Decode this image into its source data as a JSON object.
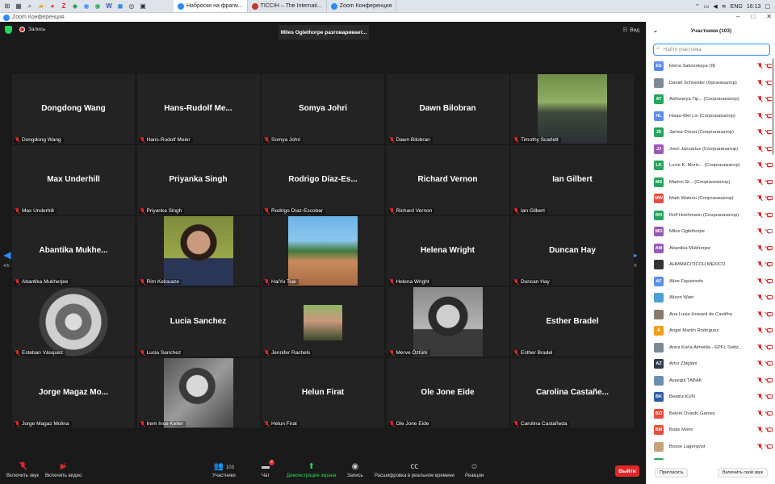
{
  "taskbar": {
    "tabs": [
      {
        "label": "Наброски на фрагм...",
        "color": "#2d8cff",
        "active": true
      },
      {
        "label": "TICCIH – The Internati...",
        "color": "#c0392b",
        "active": false
      },
      {
        "label": "Zoom Конференция",
        "color": "#2d8cff",
        "active": false
      }
    ],
    "lang": "ENG",
    "time": "16:13"
  },
  "window": {
    "title": "Zoom Конференция"
  },
  "topbar": {
    "record_label": "Запись",
    "speaker": "Miles Oglethorpe разговаривает...",
    "view_label": "Вид"
  },
  "grid": {
    "page_left": "4/5",
    "page_right": "4/5",
    "tiles": [
      {
        "big": "Dongdong Wang",
        "label": "Dongdong Wang",
        "photo": ""
      },
      {
        "big": "Hans-Rudolf  Me...",
        "label": "Hans-Rudolf Meier",
        "photo": ""
      },
      {
        "big": "Somya Johri",
        "label": "Somya Johri",
        "photo": ""
      },
      {
        "big": "Dawn Bilobran",
        "label": "Dawn Bilobran",
        "photo": ""
      },
      {
        "big": "",
        "label": "Timothy Scarlett",
        "photo": "man-suit"
      },
      {
        "big": "Max Underhill",
        "label": "Max Underhill",
        "photo": ""
      },
      {
        "big": "Priyanka Singh",
        "label": "Priyanka Singh",
        "photo": ""
      },
      {
        "big": "Rodrigo  Díaz-Es...",
        "label": "Rodrigo Díaz-Escobar",
        "photo": ""
      },
      {
        "big": "Richard Vernon",
        "label": "Richard Vernon",
        "photo": ""
      },
      {
        "big": "Ian Gilbert",
        "label": "Ian Gilbert",
        "photo": ""
      },
      {
        "big": "Abantika  Mukhe...",
        "label": "Abantika Mukherjee",
        "photo": ""
      },
      {
        "big": "",
        "label": "Rim Kelouaze",
        "photo": "woman-green"
      },
      {
        "big": "",
        "label": "HaiYu Tsai",
        "photo": "ruins"
      },
      {
        "big": "Helena Wright",
        "label": "Helena Wright",
        "photo": ""
      },
      {
        "big": "Duncan Hay",
        "label": "Duncan Hay",
        "photo": ""
      },
      {
        "big": "",
        "label": "Esteban Vásquez",
        "photo": "mountain-circle"
      },
      {
        "big": "Lucia Sanchez",
        "label": "Lucia Sanchez",
        "photo": ""
      },
      {
        "big": "",
        "label": "Jennifer Rachels",
        "photo": "small-outdoor"
      },
      {
        "big": "",
        "label": "Merve Öztürk",
        "photo": "woman-bw"
      },
      {
        "big": "Esther Bradel",
        "label": "Esther Bradel",
        "photo": ""
      },
      {
        "big": "Jorge Magaz Mo...",
        "label": "Jorge Magaz Molina",
        "photo": ""
      },
      {
        "big": "",
        "label": "Irem Ince Keller",
        "photo": "woman-bw2"
      },
      {
        "big": "Helun Firat",
        "label": "Helun Firat",
        "photo": ""
      },
      {
        "big": "Ole Jone Eide",
        "label": "Ole Jone Eide",
        "photo": ""
      },
      {
        "big": "Carolina  Castañe...",
        "label": "Carolina Castañeda",
        "photo": ""
      }
    ]
  },
  "toolbar": {
    "unmute": "Включить звук",
    "start_video": "Включить видео",
    "participants_count": "103",
    "participants": "Участники",
    "chat": "Чат",
    "chat_badge": "2",
    "share": "Демонстрация экрана",
    "record": "Запись",
    "captions": "Расшифровка в реальном времени",
    "reactions": "Реакции",
    "leave": "Выйти"
  },
  "panel": {
    "title": "Участники (103)",
    "search_placeholder": "Найти участника",
    "invite": "Пригласить",
    "unmute_me": "Включить свой звук",
    "participants": [
      {
        "initials": "ES",
        "color": "#5b8def",
        "name": "Elena Sakovskaya (Я)",
        "video": false
      },
      {
        "initials": "",
        "color": "#7a8a99",
        "name": "Daniel Schneider (Организатор)",
        "video": false
      },
      {
        "initials": "AT",
        "color": "#23a55a",
        "name": "Aishwarya Tip... (Соорганизатор)",
        "video": false
      },
      {
        "initials": "HL",
        "color": "#5b8def",
        "name": "Hsiao-Wei Lin (Соорганизатор)",
        "video": false
      },
      {
        "initials": "JD",
        "color": "#23a55a",
        "name": "James Douet (Соорганизатор)",
        "video": false
      },
      {
        "initials": "JJ",
        "color": "#9b59b6",
        "name": "Joeri Januarius (Соорганизатор)",
        "video": false
      },
      {
        "initials": "LK",
        "color": "#23a55a",
        "name": "Lucie K. Morís... (Соорганизатор)",
        "video": false
      },
      {
        "initials": "MS",
        "color": "#23a55a",
        "name": "Marion St... (Соорганизатор)",
        "video": false
      },
      {
        "initials": "MW",
        "color": "#e74c3c",
        "name": "Mark Watson (Соорганизатор)",
        "video": false
      },
      {
        "initials": "RH",
        "color": "#23a55a",
        "name": "Rolf Hoehmann (Соорганизатор)",
        "video": false
      },
      {
        "initials": "MO",
        "color": "#9b59b6",
        "name": "Miles Oglethorpe",
        "video": true
      },
      {
        "initials": "AM",
        "color": "#9b59b6",
        "name": "Abantika Mukherjee",
        "video": false
      },
      {
        "initials": "",
        "color": "#333333",
        "name": "AHMMAC/TICCH MÉXICO",
        "video": false
      },
      {
        "initials": "AF",
        "color": "#5b8def",
        "name": "Aline Figueiredo",
        "video": false
      },
      {
        "initials": "",
        "color": "#4a9fd5",
        "name": "Alison Wain",
        "video": false
      },
      {
        "initials": "",
        "color": "#8a7a6a",
        "name": "Ana Luisa Howard de Castilho",
        "video": false
      },
      {
        "initials": "Á",
        "color": "#f39c12",
        "name": "Ángel Martín Rodríguez",
        "video": false
      },
      {
        "initials": "",
        "color": "#7a8a99",
        "name": "Anna Karla Almeida - EPFL Switz...",
        "video": false
      },
      {
        "initials": "AZ",
        "color": "#2c3e50",
        "name": "Artur Zbiglani",
        "video": false
      },
      {
        "initials": "",
        "color": "#6a8fb0",
        "name": "Ayşegül TABAK",
        "video": false
      },
      {
        "initials": "BK",
        "color": "#2c5fa8",
        "name": "Beatriz KÜN",
        "video": false
      },
      {
        "initials": "BO",
        "color": "#e74c3c",
        "name": "Belem Oviedo Gámez",
        "video": false
      },
      {
        "initials": "BM",
        "color": "#e74c3c",
        "name": "Bode Morin",
        "video": false
      },
      {
        "initials": "",
        "color": "#c9a27a",
        "name": "Bosse Lagerqvist",
        "video": false
      },
      {
        "initials": "CC",
        "color": "#23a55a",
        "name": "Carolina Castañeda",
        "video": false
      }
    ]
  }
}
